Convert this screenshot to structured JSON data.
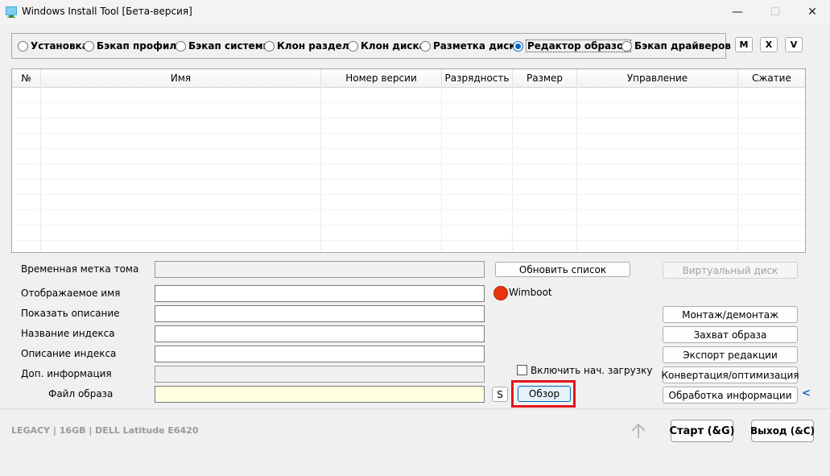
{
  "window": {
    "title": "Windows Install Tool [Бета-версия]",
    "controls": {
      "minimize": "—",
      "maximize": "☐",
      "close": "✕"
    }
  },
  "modes": {
    "items": [
      {
        "label": "Установка",
        "selected": false
      },
      {
        "label": "Бэкап профиля",
        "selected": false
      },
      {
        "label": "Бэкап системы",
        "selected": false
      },
      {
        "label": "Клон раздела",
        "selected": false
      },
      {
        "label": "Клон диска",
        "selected": false
      },
      {
        "label": "Разметка диска",
        "selected": false
      },
      {
        "label": "Редактор образов",
        "selected": true
      },
      {
        "label": "Бэкап драйверов",
        "selected": false
      }
    ],
    "small_buttons": {
      "m": "M",
      "x": "X",
      "v": "V"
    }
  },
  "table": {
    "columns": [
      "№",
      "Имя",
      "Номер версии",
      "Разрядность",
      "Размер",
      "Управление",
      "Сжатие"
    ],
    "rows": []
  },
  "form": {
    "volume_label": {
      "label": "Временная метка тома",
      "value": ""
    },
    "display_name": {
      "label": "Отображаемое имя",
      "value": ""
    },
    "show_description": {
      "label": "Показать описание",
      "value": ""
    },
    "index_name": {
      "label": "Название индекса",
      "value": ""
    },
    "index_description": {
      "label": "Описание индекса",
      "value": ""
    },
    "extra_info": {
      "label": "Доп. информация",
      "value": ""
    },
    "image_file": {
      "label": "Файл образа",
      "value": ""
    }
  },
  "controls": {
    "refresh_list": "Обновить список",
    "wimboot_label": "Wimboot",
    "wimboot_color": "#e8340c",
    "enable_boot_label": "Включить нач. загрузку",
    "s_button": "S",
    "browse": "Обзор"
  },
  "side_buttons": {
    "virtual_disk": "Виртуальный диск",
    "mount": "Монтаж/демонтаж",
    "capture": "Захват образа",
    "export": "Экспорт редакции",
    "convert": "Конвертация/оптимизация",
    "process_info": "Обработка информации",
    "collapse_arrow": "<"
  },
  "footer": {
    "status": "LEGACY | 16GB | DELL Latitude E6420",
    "start": "Старт (&G)",
    "exit": "Выход (&C)"
  },
  "colors": {
    "accent": "#0067c0",
    "highlight": "#e1141c"
  }
}
